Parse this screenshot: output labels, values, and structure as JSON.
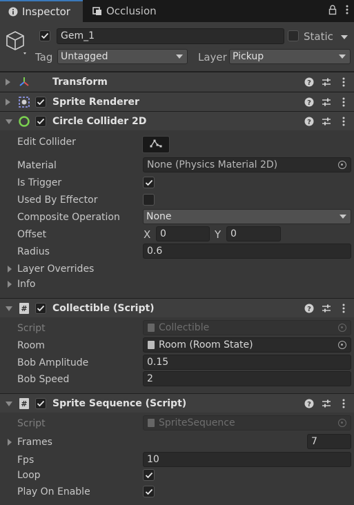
{
  "tabs": [
    {
      "label": "Inspector",
      "icon": "info-icon",
      "active": true
    },
    {
      "label": "Occlusion",
      "icon": "occlusion-icon",
      "active": false
    }
  ],
  "header": {
    "name": "Gem_1",
    "static_label": "Static",
    "tag_label": "Tag",
    "tag_value": "Untagged",
    "layer_label": "Layer",
    "layer_value": "Pickup"
  },
  "components": {
    "transform": {
      "title": "Transform"
    },
    "sprite_renderer": {
      "title": "Sprite Renderer"
    },
    "circle_collider": {
      "title": "Circle Collider 2D",
      "edit_collider_label": "Edit Collider",
      "material_label": "Material",
      "material_value": "None (Physics Material 2D)",
      "is_trigger_label": "Is Trigger",
      "used_by_effector_label": "Used By Effector",
      "composite_label": "Composite Operation",
      "composite_value": "None",
      "offset_label": "Offset",
      "offset_x_label": "X",
      "offset_x": "0",
      "offset_y_label": "Y",
      "offset_y": "0",
      "radius_label": "Radius",
      "radius_value": "0.6",
      "layer_overrides_label": "Layer Overrides",
      "info_label": "Info"
    },
    "collectible": {
      "title": "Collectible (Script)",
      "script_label": "Script",
      "script_value": "Collectible",
      "room_label": "Room",
      "room_value": "Room (Room State)",
      "bob_amplitude_label": "Bob Amplitude",
      "bob_amplitude_value": "0.15",
      "bob_speed_label": "Bob Speed",
      "bob_speed_value": "2"
    },
    "sprite_sequence": {
      "title": "Sprite Sequence (Script)",
      "script_label": "Script",
      "script_value": "SpriteSequence",
      "frames_label": "Frames",
      "frames_value": "7",
      "fps_label": "Fps",
      "fps_value": "10",
      "loop_label": "Loop",
      "play_on_enable_label": "Play On Enable"
    }
  },
  "colors": {
    "accent": "#3a79bb",
    "panel": "#383838",
    "header": "#3e3e3e",
    "field": "#2a2a2a"
  }
}
